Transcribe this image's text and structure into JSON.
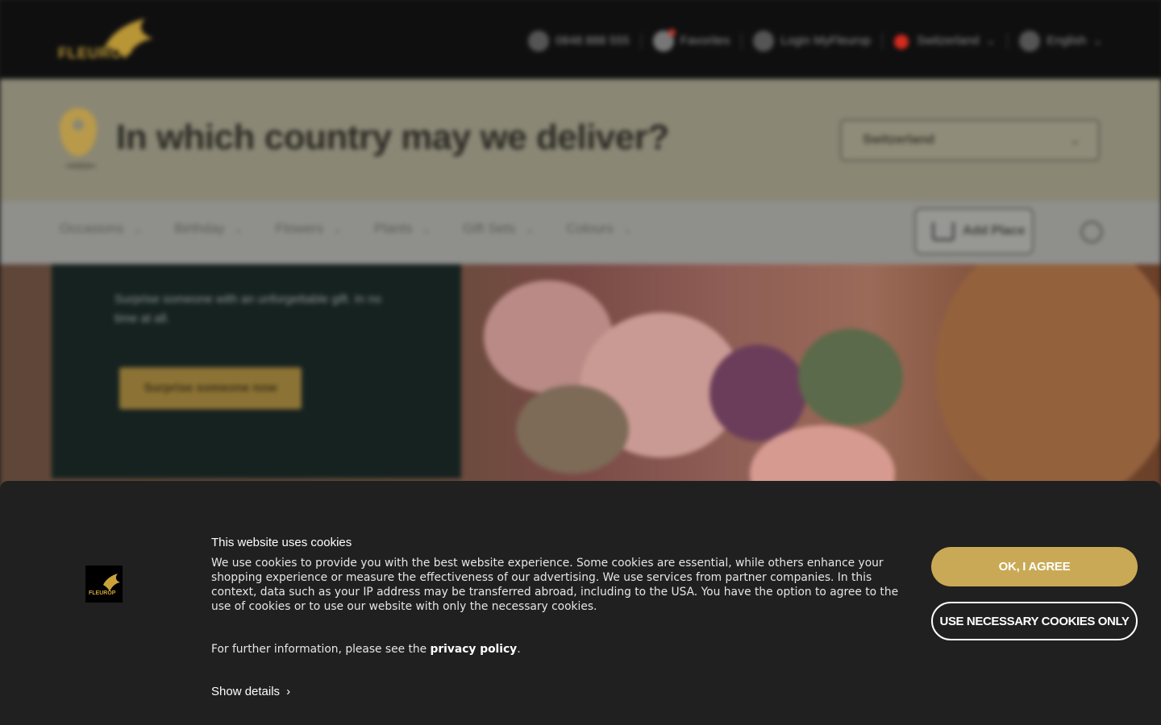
{
  "header": {
    "logo_text": "FLEUROP",
    "phone": "0848 888 555",
    "favourites_label": "Favorites",
    "login_label": "Login MyFleurop",
    "country_label": "Switzerland",
    "language_label": "English"
  },
  "delivery": {
    "title": "In which country may we deliver?",
    "selected_country": "Switzerland"
  },
  "nav": {
    "items": [
      "Occasions",
      "Birthday",
      "Flowers",
      "Plants",
      "Gift Sets",
      "Colours"
    ],
    "add_place_label": "Add Place"
  },
  "hero": {
    "text": "Surprise someone with an unforgettable gift. In no time at all.",
    "button_label": "Surprise someone now"
  },
  "cookie": {
    "logo_text": "FLEUROP",
    "title": "This website uses cookies",
    "body": "We use cookies to provide you with the best website experience. Some cookies are essential, while others enhance your shopping experience or measure the effectiveness of our advertising. We use services from partner companies. In this context, data such as your IP address may be transferred abroad, including to the USA. You have the option to agree to the use of cookies or to use our website with only the necessary cookies.",
    "further_prefix": "For further information, please see the ",
    "privacy_link": "privacy policy",
    "further_suffix": ".",
    "show_details": "Show details",
    "agree_button": "OK, I AGREE",
    "necessary_button": "USE NECESSARY COOKIES ONLY"
  },
  "colors": {
    "accent_gold": "#c9a955",
    "banner_bg": "#202020",
    "topbar_bg": "#0f0f10"
  }
}
